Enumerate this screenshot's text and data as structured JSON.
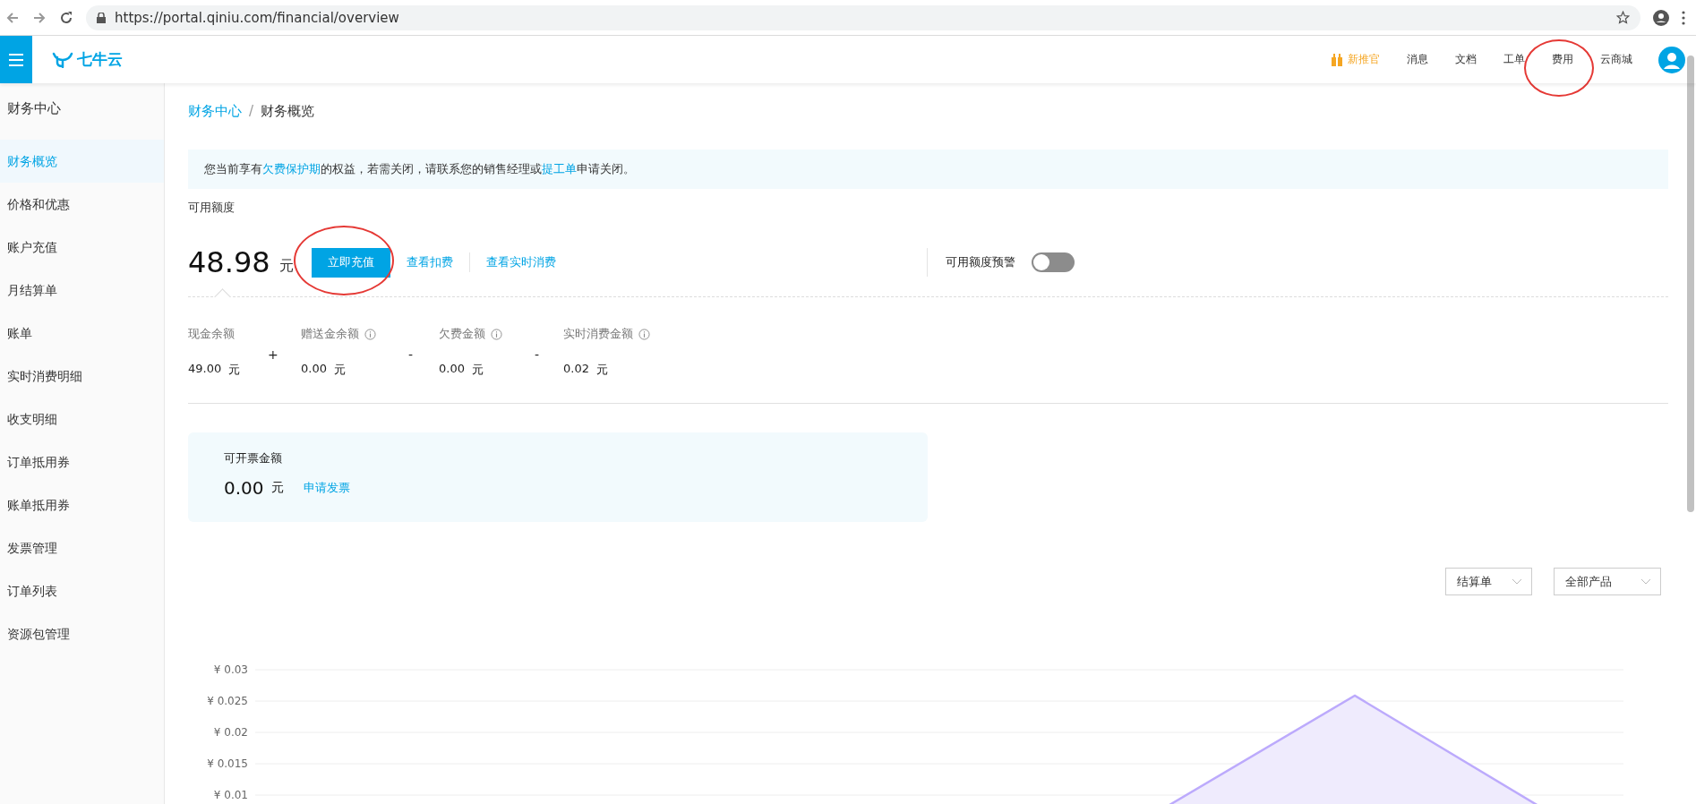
{
  "browser": {
    "url": "https://portal.qiniu.com/financial/overview"
  },
  "header": {
    "logo": "七牛云",
    "nav": [
      {
        "label": "新推官",
        "kind": "promo"
      },
      {
        "label": "消息",
        "kind": "link"
      },
      {
        "label": "文档",
        "kind": "link"
      },
      {
        "label": "工单",
        "kind": "link"
      },
      {
        "label": "费用",
        "kind": "link"
      },
      {
        "label": "云商城",
        "kind": "link"
      }
    ]
  },
  "sidebar": {
    "title": "财务中心",
    "items": [
      {
        "label": "财务概览",
        "selected": true
      },
      {
        "label": "价格和优惠",
        "selected": false
      },
      {
        "label": "账户充值",
        "selected": false
      },
      {
        "label": "月结算单",
        "selected": false
      },
      {
        "label": "账单",
        "selected": false
      },
      {
        "label": "实时消费明细",
        "selected": false
      },
      {
        "label": "收支明细",
        "selected": false
      },
      {
        "label": "订单抵用券",
        "selected": false
      },
      {
        "label": "账单抵用券",
        "selected": false
      },
      {
        "label": "发票管理",
        "selected": false
      },
      {
        "label": "订单列表",
        "selected": false
      },
      {
        "label": "资源包管理",
        "selected": false
      }
    ]
  },
  "breadcrumb": {
    "separator": "/",
    "items": [
      {
        "label": "财务中心",
        "kind": "link"
      },
      {
        "label": "财务概览",
        "kind": "current"
      }
    ]
  },
  "notice": [
    {
      "text": "您当前享有",
      "link": false
    },
    {
      "text": "欠费保护期",
      "link": true
    },
    {
      "text": "的权益，若需关闭，请联系您的销售经理或",
      "link": false
    },
    {
      "text": "提工单",
      "link": true
    },
    {
      "text": "申请关闭。",
      "link": false
    }
  ],
  "balance": {
    "label": "可用额度",
    "amount": "48.98",
    "unit": "元",
    "recharge_button": "立即充值",
    "links": [
      "查看扣费",
      "查看实时消费"
    ],
    "alert": {
      "label": "可用额度预警",
      "on": false
    }
  },
  "metrics": [
    {
      "label": "现金余额",
      "info": false,
      "value": "49.00",
      "unit": "元",
      "operator": "+"
    },
    {
      "label": "赠送金余额",
      "info": true,
      "value": "0.00",
      "unit": "元",
      "operator": "-"
    },
    {
      "label": "欠费金额",
      "info": true,
      "value": "0.00",
      "unit": "元",
      "operator": "-"
    },
    {
      "label": "实时消费金额",
      "info": true,
      "value": "0.02",
      "unit": "元"
    }
  ],
  "invoice": {
    "label": "可开票金额",
    "amount": "0.00",
    "unit": "元",
    "link": "申请发票"
  },
  "filters": [
    {
      "value": "结算单"
    },
    {
      "value": "全部产品"
    }
  ],
  "chart": {
    "y_ticks": [
      "¥ 0.03",
      "¥ 0.025",
      "¥ 0.02",
      "¥ 0.015",
      "¥ 0.01"
    ]
  }
}
